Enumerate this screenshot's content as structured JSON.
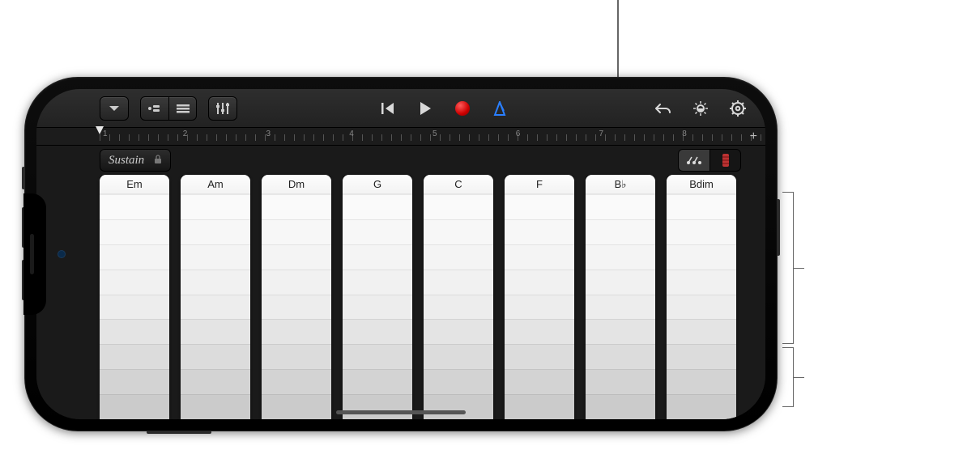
{
  "toolbar": {
    "ruler_bars": [
      "1",
      "2",
      "3",
      "4",
      "5",
      "6",
      "7",
      "8"
    ]
  },
  "strip": {
    "sustain_label": "Sustain"
  },
  "chords": {
    "labels": [
      "Em",
      "Am",
      "Dm",
      "G",
      "C",
      "F",
      "B♭",
      "Bdim"
    ]
  },
  "colors": {
    "record": "#cc0000",
    "metronome": "#2a7fff"
  }
}
